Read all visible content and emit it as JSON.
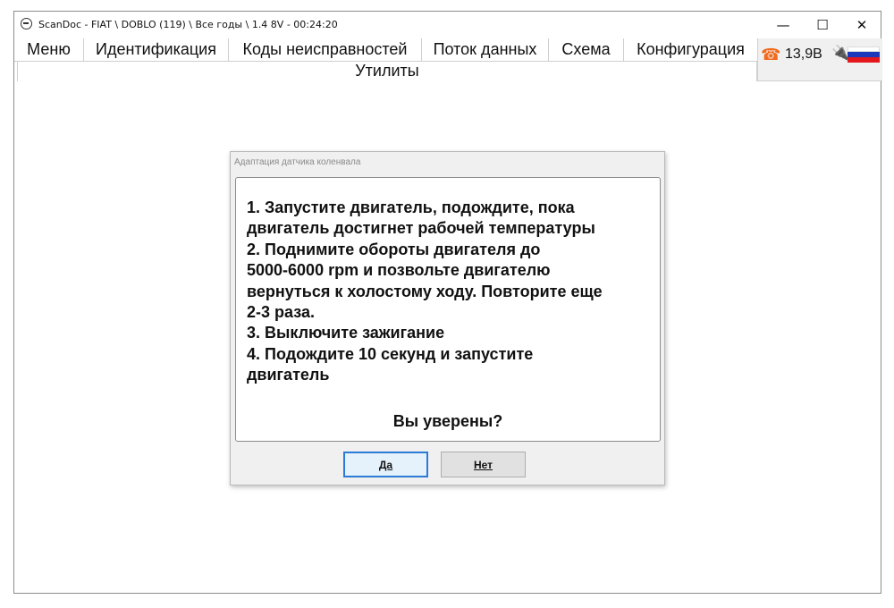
{
  "window": {
    "title": "ScanDoc - FIAT \\ DOBLO (119) \\ Все годы \\ 1.4 8V - 00:24:20",
    "controls": {
      "minimize": "—",
      "maximize": "☐",
      "close": "✕"
    }
  },
  "menu": {
    "items": [
      "Меню",
      "Идентификация",
      "Коды неисправностей",
      "Поток данных",
      "Схема",
      "Конфигурация"
    ],
    "active_submenu": "Утилиты"
  },
  "status": {
    "voltage": "13,9В",
    "phone_icon": "☎",
    "plug_icon": "🔌",
    "flag_colors": [
      "#ffffff",
      "#1c39bb",
      "#e4181c"
    ]
  },
  "dialog": {
    "title": "Адаптация датчика коленвала",
    "message": "1. Запустите двигатель, подождите, пока\nдвигатель достигнет рабочей температуры\n2. Поднимите обороты двигателя до\n5000-6000 rpm  и позвольте двигателю\nвернуться к холостому ходу. Повторите еще\n2-3 раза.\n3. Выключите зажигание\n4. Подождите 10 секунд и запустите\nдвигатель",
    "confirm": "Вы уверены?",
    "yes_label": "Да",
    "no_label": "Нет"
  }
}
